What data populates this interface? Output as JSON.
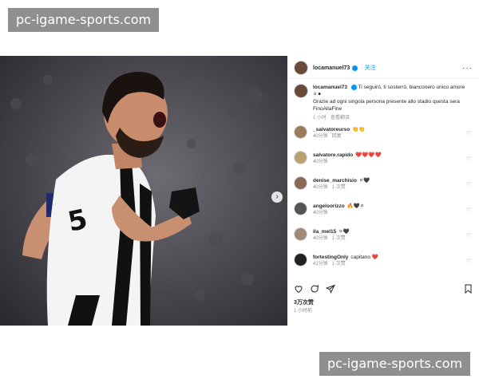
{
  "watermark": {
    "text": "pc-igame-sports.com"
  },
  "post": {
    "username": "locamanuel73",
    "follow_label": "· 关注",
    "more_label": "···",
    "caption": {
      "username": "locamanuel73",
      "text": "Ti seguirò, ti sosterrò, bianconero unico amore",
      "emoji": "⚪⚫",
      "line2": "Grazie ad ogni singola persona presente allo stadio questa sera",
      "line3": "FinoAllaFine",
      "time": "1 小时",
      "translate": "查看翻译"
    },
    "comments": [
      {
        "user": "_salvatoreurso",
        "text": "👏👏",
        "time": "40分钟",
        "reply": "回复"
      },
      {
        "user": "salvatore.rapido",
        "text": "❤️❤️❤️❤️",
        "time": "40分钟",
        "reply": ""
      },
      {
        "user": "denise_marchisio",
        "text": "⚪🖤",
        "time": "40分钟",
        "reply": "1 次赞"
      },
      {
        "user": "angeloorizzo",
        "text": "🔥🖤⚪",
        "time": "40分钟",
        "reply": ""
      },
      {
        "user": "ila_mel15",
        "text": "⚪🖤",
        "time": "40分钟",
        "reply": "1 次赞"
      },
      {
        "user": "fortestingOnly",
        "text": "capitano ❤️",
        "time": "41分钟",
        "reply": "1 次赞"
      }
    ],
    "likes": "3万次赞",
    "posted": "1 小时前"
  },
  "colors": {
    "accent": "#0095f6",
    "text": "#262626",
    "muted": "#8e8e8e"
  }
}
